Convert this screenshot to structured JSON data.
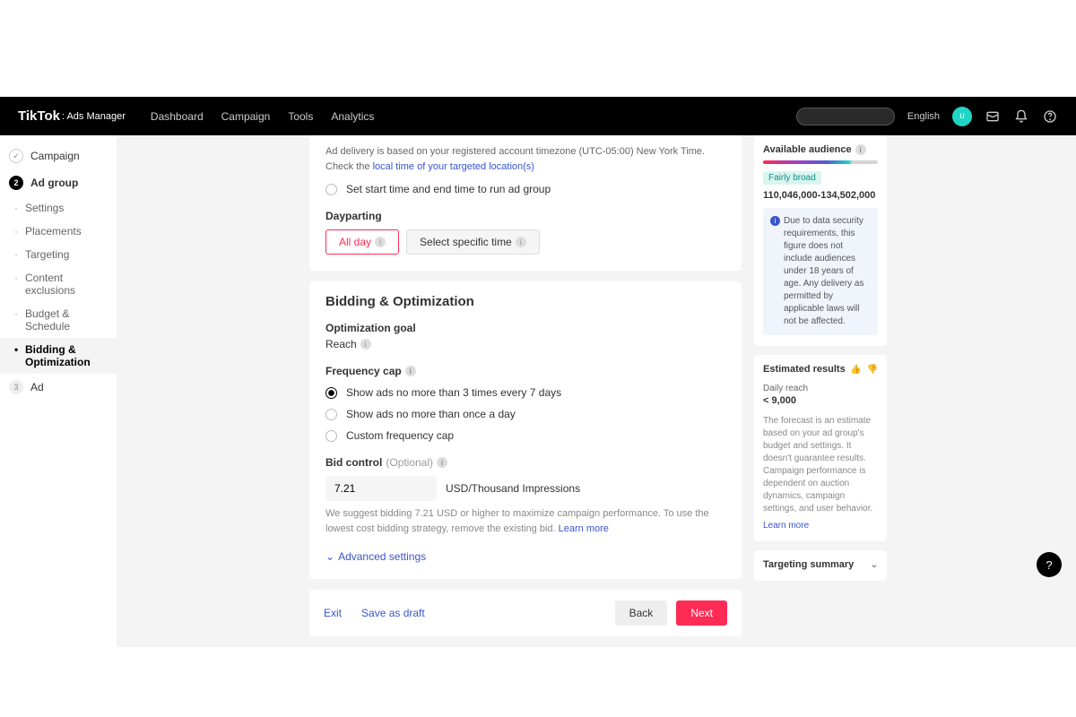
{
  "header": {
    "logo": "TikTok",
    "logo_sub": ": Ads Manager",
    "nav": [
      "Dashboard",
      "Campaign",
      "Tools",
      "Analytics"
    ],
    "language": "English",
    "avatar_initial": "u"
  },
  "sidebar": {
    "steps": {
      "campaign": "Campaign",
      "adgroup": "Ad group",
      "ad": "Ad"
    },
    "subs": [
      "Settings",
      "Placements",
      "Targeting",
      "Content exclusions",
      "Budget & Schedule",
      "Bidding & Optimization"
    ]
  },
  "schedule": {
    "tz_prefix": "Ad delivery is based on your registered account timezone ",
    "tz_value": "(UTC-05:00) New York Time",
    "tz_suffix": ". Check the ",
    "tz_link": "local time of your targeted location(s)",
    "start_end": "Set start time and end time to run ad group",
    "dayparting_label": "Dayparting",
    "all_day": "All day",
    "select_time": "Select specific time"
  },
  "bidding": {
    "title": "Bidding & Optimization",
    "opt_goal_label": "Optimization goal",
    "opt_goal_value": "Reach",
    "freq_label": "Frequency cap",
    "freq_options": [
      "Show ads no more than 3 times every 7 days",
      "Show ads no more than once a day",
      "Custom frequency cap"
    ],
    "bid_label": "Bid control",
    "optional": "(Optional)",
    "bid_value": "7.21",
    "bid_unit": "USD/Thousand Impressions",
    "suggest_prefix": "We suggest bidding ",
    "suggest_amount": "7.21 USD",
    "suggest_suffix": " or higher to maximize campaign performance. To use the lowest cost bidding strategy, remove the existing bid. ",
    "learn_more": "Learn more",
    "advanced": "Advanced settings"
  },
  "footer": {
    "exit": "Exit",
    "save_draft": "Save as draft",
    "back": "Back",
    "next": "Next"
  },
  "audience": {
    "title": "Available audience",
    "breadth": "Fairly broad",
    "range": "110,046,000-134,502,000",
    "note": "Due to data security requirements, this figure does not include audiences under 18 years of age. Any delivery as permitted by applicable laws will not be affected."
  },
  "estimates": {
    "title": "Estimated results",
    "reach_label": "Daily reach",
    "reach_value": "< 9,000",
    "forecast": "The forecast is an estimate based on your ad group's budget and settings. It doesn't guarantee results. Campaign performance is dependent on auction dynamics, campaign settings, and user behavior.",
    "learn_more": "Learn more"
  },
  "targeting_summary": "Targeting summary"
}
